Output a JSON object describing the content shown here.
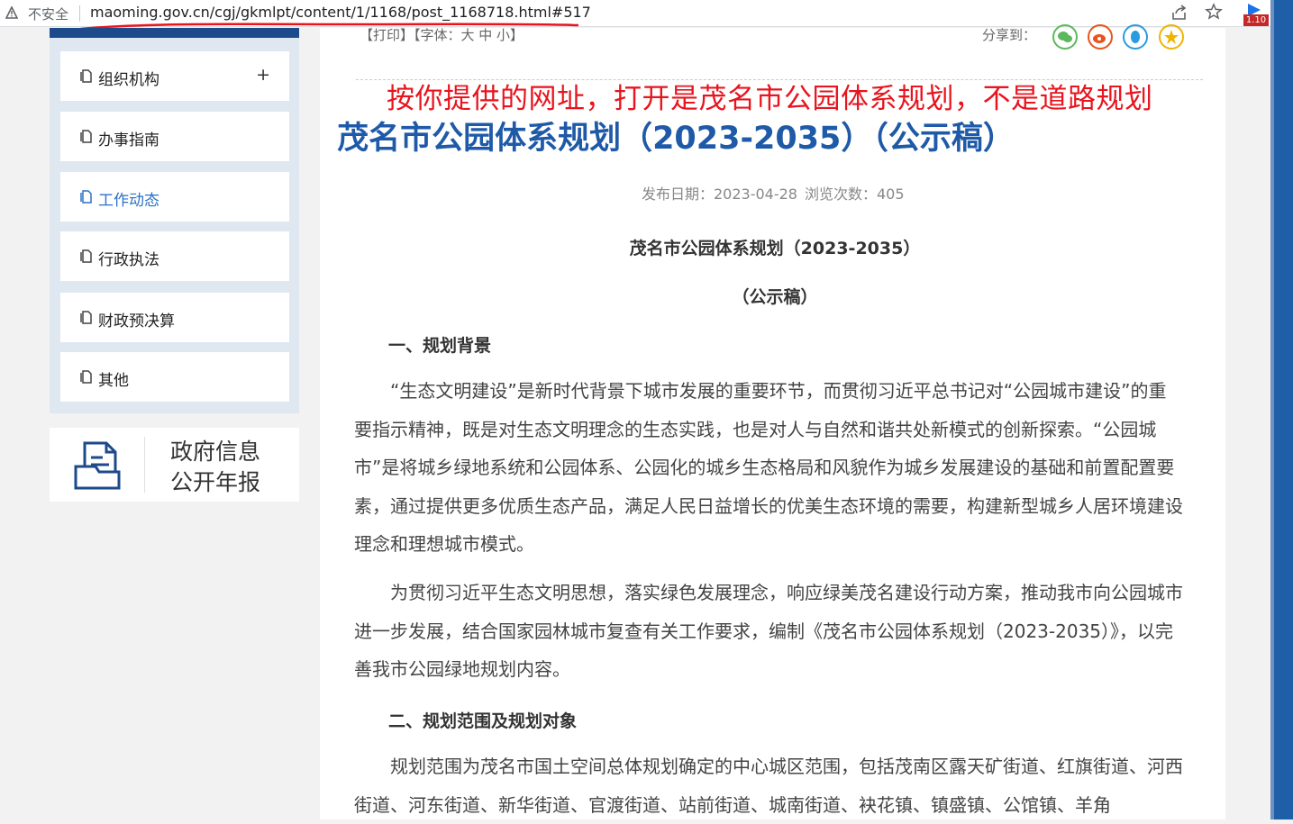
{
  "browser": {
    "security_label": "不安全",
    "url": "maoming.gov.cn/cgj/gkmlpt/content/1/1168/post_1168718.html#517",
    "extension_badge": "1.10"
  },
  "sidebar": {
    "items": [
      {
        "label": "组织机构",
        "expand": "+"
      },
      {
        "label": "办事指南"
      },
      {
        "label": "工作动态"
      },
      {
        "label": "行政执法"
      },
      {
        "label": "财政预决算"
      },
      {
        "label": "其他"
      }
    ],
    "annual_report": {
      "line1": "政府信息",
      "line2": "公开年报"
    }
  },
  "toolbar": {
    "print": "【打印】",
    "font": "【字体：大 中 小】",
    "share_label": "分享到："
  },
  "annotation": "按你提供的网址，打开是茂名市公园体系规划，不是道路规划",
  "article": {
    "title": "茂名市公园体系规划（2023-2035）（公示稿）",
    "publish_label": "发布日期：2023-04-28",
    "views_label": "浏览次数：405",
    "doc_title": "茂名市公园体系规划（2023-2035）",
    "doc_subtitle": "（公示稿）",
    "section1": "一、规划背景",
    "p1": "“生态文明建设”是新时代背景下城市发展的重要环节，而贯彻习近平总书记对“公园城市建设”的重要指示精神，既是对生态文明理念的生态实践，也是对人与自然和谐共处新模式的创新探索。“公园城市”是将城乡绿地系统和公园体系、公园化的城乡生态格局和风貌作为城乡发展建设的基础和前置配置要素，通过提供更多优质生态产品，满足人民日益增长的优美生态环境的需要，构建新型城乡人居环境建设理念和理想城市模式。",
    "p2": "为贯彻习近平生态文明思想，落实绿色发展理念，响应绿美茂名建设行动方案，推动我市向公园城市进一步发展，结合国家园林城市复查有关工作要求，编制《茂名市公园体系规划（2023-2035）》，以完善我市公园绿地规划内容。",
    "section2": "二、规划范围及规划对象",
    "p3": "规划范围为茂名市国土空间总体规划确定的中心城区范围，包括茂南区露天矿街道、红旗街道、河西街道、河东街道、新华街道、官渡街道、站前街道、城南街道、袂花镇、镇盛镇、公馆镇、羊角"
  }
}
